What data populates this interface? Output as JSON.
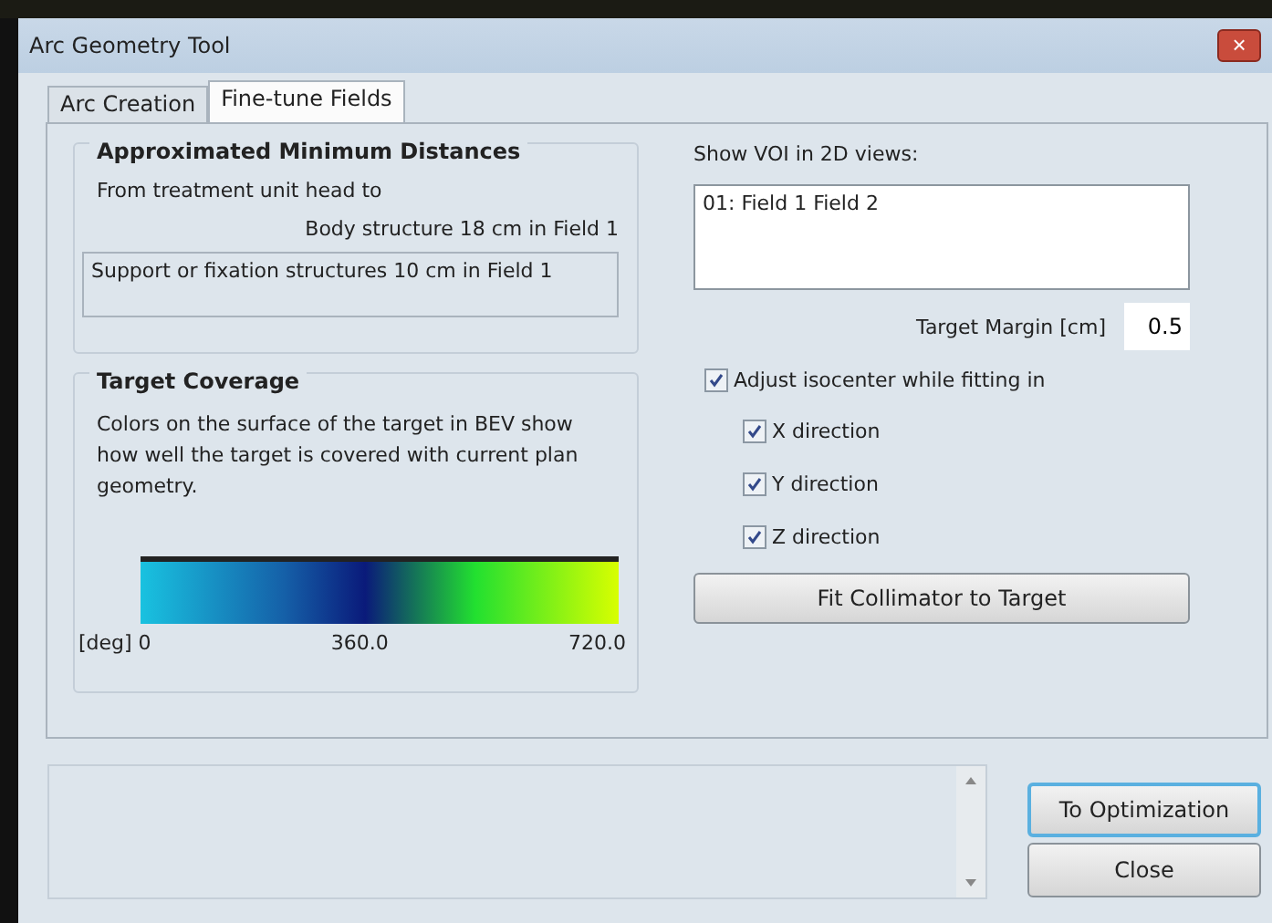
{
  "window": {
    "title": "Arc Geometry Tool",
    "close_label": "×"
  },
  "tabs": [
    {
      "label": "Arc Creation",
      "selected": false
    },
    {
      "label": "Fine-tune Fields",
      "selected": true
    }
  ],
  "distances": {
    "title": "Approximated Minimum Distances",
    "intro": "From treatment unit head to",
    "body": "Body structure 18 cm in Field 1",
    "support": "Support or fixation structures 10 cm in Field 1"
  },
  "coverage": {
    "title": "Target Coverage",
    "description": "Colors on the surface of the target in BEV show how well the target is covered with current plan geometry.",
    "scale_labels": [
      "[deg] 0",
      "360.0",
      "720.0"
    ]
  },
  "voi": {
    "label": "Show VOI in 2D views:",
    "items": [
      "01: Field 1 Field 2"
    ]
  },
  "margin": {
    "label": "Target Margin [cm]",
    "value": "0.5"
  },
  "adjust": {
    "label": "Adjust isocenter while fitting in",
    "checked": true
  },
  "directions": [
    {
      "label": "X direction",
      "checked": true
    },
    {
      "label": "Y direction",
      "checked": true
    },
    {
      "label": "Z direction",
      "checked": true
    }
  ],
  "fit_button": "Fit Collimator to Target",
  "buttons": [
    {
      "label": "To Optimization",
      "selected": true
    },
    {
      "label": "Close",
      "selected": false
    }
  ]
}
